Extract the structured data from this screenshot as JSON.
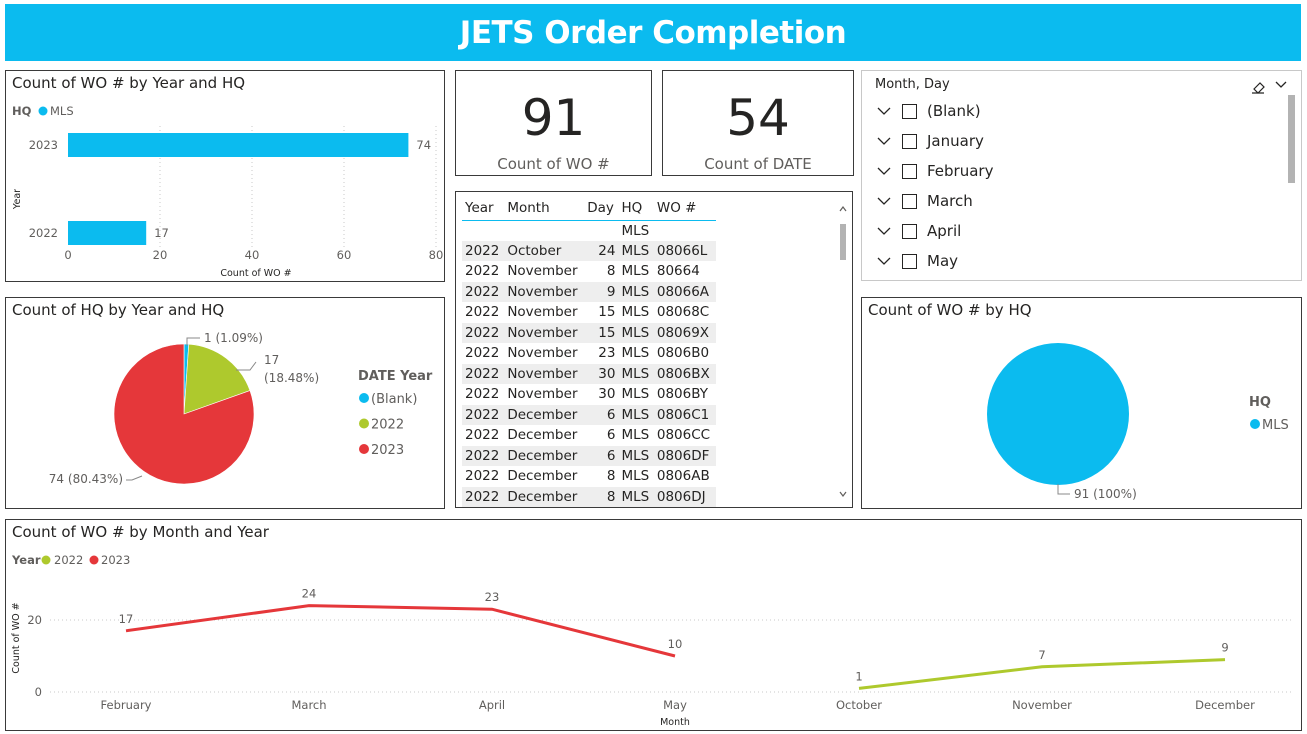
{
  "title": "JETS Order Completion",
  "bar_panel": {
    "title": "Count of WO # by Year and HQ",
    "legend_title": "HQ",
    "legend_item": "MLS",
    "ylabel": "Year",
    "xlabel": "Count of WO #",
    "color": "#0bbbef"
  },
  "card_wo": {
    "value": "91",
    "label": "Count of WO #"
  },
  "card_date": {
    "value": "54",
    "label": "Count of DATE"
  },
  "slicer": {
    "title": "Month, Day",
    "items": [
      "(Blank)",
      "January",
      "February",
      "March",
      "April",
      "May"
    ]
  },
  "table": {
    "headers": [
      "Year",
      "Month",
      "Day",
      "HQ",
      "WO #"
    ],
    "rows": [
      [
        "",
        "",
        "",
        "MLS",
        ""
      ],
      [
        "2022",
        "October",
        "24",
        "MLS",
        "08066L"
      ],
      [
        "2022",
        "November",
        "8",
        "MLS",
        "80664"
      ],
      [
        "2022",
        "November",
        "9",
        "MLS",
        "08066A"
      ],
      [
        "2022",
        "November",
        "15",
        "MLS",
        "08068C"
      ],
      [
        "2022",
        "November",
        "15",
        "MLS",
        "08069X"
      ],
      [
        "2022",
        "November",
        "23",
        "MLS",
        "0806B0"
      ],
      [
        "2022",
        "November",
        "30",
        "MLS",
        "0806BX"
      ],
      [
        "2022",
        "November",
        "30",
        "MLS",
        "0806BY"
      ],
      [
        "2022",
        "December",
        "6",
        "MLS",
        "0806C1"
      ],
      [
        "2022",
        "December",
        "6",
        "MLS",
        "0806CC"
      ],
      [
        "2022",
        "December",
        "6",
        "MLS",
        "0806DF"
      ],
      [
        "2022",
        "December",
        "8",
        "MLS",
        "0806AB"
      ],
      [
        "2022",
        "December",
        "8",
        "MLS",
        "0806DJ"
      ]
    ]
  },
  "pie_panel": {
    "title": "Count of HQ by Year and HQ",
    "legend_title": "DATE Year",
    "legend_items": [
      "(Blank)",
      "2022",
      "2023"
    ],
    "labels": [
      "1 (1.09%)",
      "17",
      "(18.48%)",
      "74 (80.43%)"
    ]
  },
  "pie2_panel": {
    "title": "Count of WO # by HQ",
    "legend_title": "HQ",
    "legend_item": "MLS",
    "label": "91 (100%)"
  },
  "line_panel": {
    "title": "Count of WO # by Month and Year",
    "legend_title": "Year",
    "legend_items": [
      "2022",
      "2023"
    ],
    "xlabel": "Month",
    "ylabel": "Count of WO #"
  },
  "colors": {
    "blue": "#0bbbef",
    "green": "#aec92d",
    "red": "#e5373a",
    "grid": "#c8c8c8"
  },
  "chart_data": [
    {
      "type": "bar",
      "orientation": "horizontal",
      "title": "Count of WO # by Year and HQ",
      "categories": [
        "2023",
        "2022"
      ],
      "series": [
        {
          "name": "MLS",
          "values": [
            74,
            17
          ]
        }
      ],
      "xlabel": "Count of WO #",
      "ylabel": "Year",
      "xlim": [
        0,
        80
      ],
      "xticks": [
        0,
        20,
        40,
        60,
        80
      ],
      "grid": true,
      "legend": "top-left"
    },
    {
      "type": "pie",
      "title": "Count of HQ by Year and HQ",
      "categories": [
        "(Blank)",
        "2022",
        "2023"
      ],
      "values": [
        1,
        17,
        74
      ],
      "legend": "right"
    },
    {
      "type": "pie",
      "title": "Count of WO # by HQ",
      "categories": [
        "MLS"
      ],
      "values": [
        91
      ],
      "legend": "right"
    },
    {
      "type": "line",
      "title": "Count of WO # by Month and Year",
      "categories": [
        "February",
        "March",
        "April",
        "May",
        "October",
        "November",
        "December"
      ],
      "series": [
        {
          "name": "2022",
          "values": [
            null,
            null,
            null,
            null,
            1,
            7,
            9
          ]
        },
        {
          "name": "2023",
          "values": [
            17,
            24,
            23,
            10,
            null,
            null,
            null
          ]
        }
      ],
      "xlabel": "Month",
      "ylabel": "Count of WO #",
      "yticks": [
        0,
        20
      ],
      "grid": true,
      "legend": "top-left"
    }
  ]
}
